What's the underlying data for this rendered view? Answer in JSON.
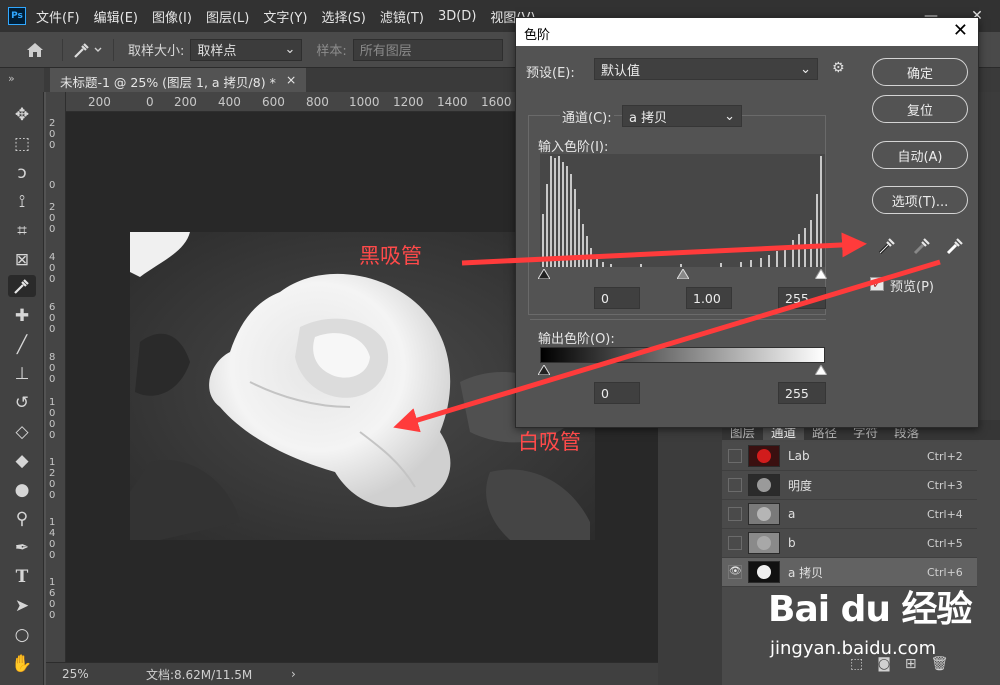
{
  "menubar": {
    "logo": "Ps",
    "items": [
      "文件(F)",
      "编辑(E)",
      "图像(I)",
      "图层(L)",
      "文字(Y)",
      "选择(S)",
      "滤镜(T)",
      "3D(D)",
      "视图(V)"
    ],
    "minimize": "—",
    "close": "✕"
  },
  "options": {
    "sample_size_label": "取样大小:",
    "sample_size_value": "取样点",
    "sample_label": "样本:",
    "sample_value": "所有图层"
  },
  "document": {
    "tab_title": "未标题-1 @ 25% (图层 1, a 拷贝/8) *",
    "tab_close": "×",
    "collapse": "»"
  },
  "ruler": {
    "top": [
      "200",
      "0",
      "200",
      "400",
      "600",
      "800",
      "1000",
      "1200",
      "1400",
      "1600"
    ],
    "left": [
      "2\n0\n0",
      "0",
      "2\n0\n0",
      "4\n0\n0",
      "6\n0\n0",
      "8\n0\n0",
      "1\n0\n0\n0",
      "1\n2\n0\n0",
      "1\n4\n0\n0",
      "1\n6\n0\n0"
    ]
  },
  "status": {
    "zoom": "25%",
    "doc_info": "文档:8.62M/11.5M",
    "arrow": "›"
  },
  "levels": {
    "title": "色阶",
    "preset_label": "预设(E):",
    "preset_value": "默认值",
    "channel_label": "通道(C):",
    "channel_value": "a 拷贝",
    "input_label": "输入色阶(I):",
    "input_black": "0",
    "input_mid": "1.00",
    "input_white": "255",
    "output_label": "输出色阶(O):",
    "output_black": "0",
    "output_white": "255",
    "buttons": {
      "ok": "确定",
      "reset": "复位",
      "auto": "自动(A)",
      "options": "选项(T)..."
    },
    "preview_label": "预览(P)",
    "preview_checked": true
  },
  "channels": {
    "tabs": [
      "图层",
      "通道",
      "路径",
      "字符",
      "段落"
    ],
    "active_tab": 1,
    "rows": [
      {
        "name": "Lab",
        "shortcut": "Ctrl+2",
        "visible": false
      },
      {
        "name": "明度",
        "shortcut": "Ctrl+3",
        "visible": false
      },
      {
        "name": "a",
        "shortcut": "Ctrl+4",
        "visible": false
      },
      {
        "name": "b",
        "shortcut": "Ctrl+5",
        "visible": false
      },
      {
        "name": "a 拷贝",
        "shortcut": "Ctrl+6",
        "visible": true
      }
    ]
  },
  "annotations": {
    "black_eyedropper": "黑吸管",
    "white_eyedropper": "白吸管",
    "color": "#ff4a4a"
  },
  "watermark": {
    "logo": "Bai du 经验",
    "url": "jingyan.baidu.com"
  }
}
